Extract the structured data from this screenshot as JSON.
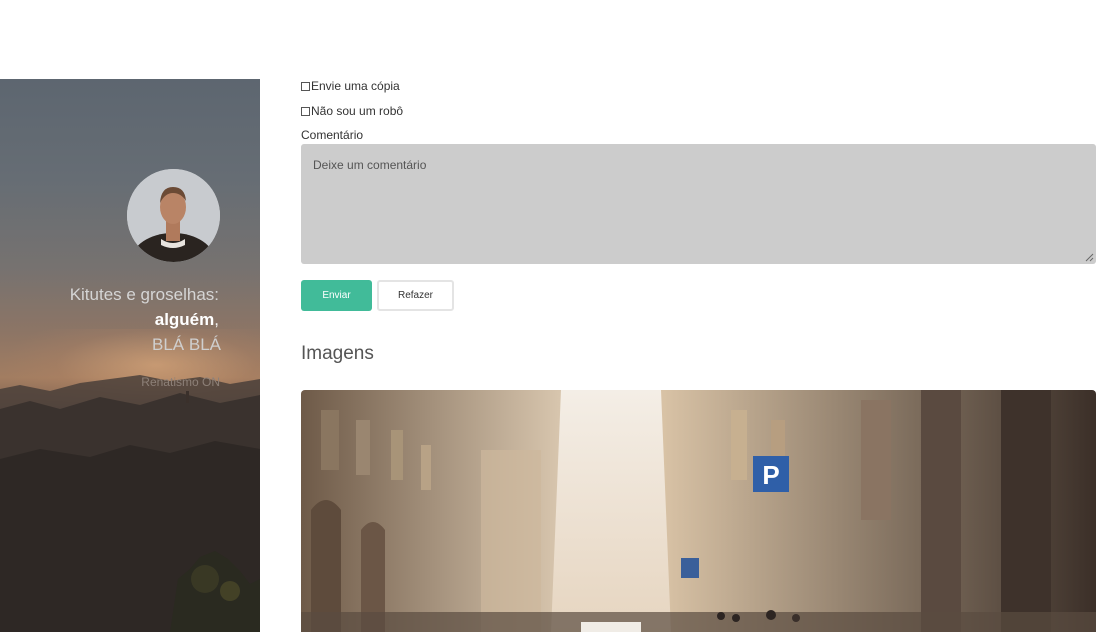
{
  "sidebar": {
    "tagline": "Kitutes e groselhas:",
    "name_bold": "alguém",
    "name_suffix": ",",
    "extra": "BLÁ BLÁ",
    "footer": "Renatismo ON"
  },
  "form": {
    "checkbox_copy_label": "Envie uma cópia",
    "checkbox_robot_label": "Não sou um robô",
    "comment_label": "Comentário",
    "comment_placeholder": "Deixe um comentário",
    "comment_value": "",
    "send_label": "Enviar",
    "reset_label": "Refazer"
  },
  "images_section": {
    "title": "Imagens"
  },
  "colors": {
    "accent": "#41bb99",
    "textarea_bg": "#cccccc"
  }
}
